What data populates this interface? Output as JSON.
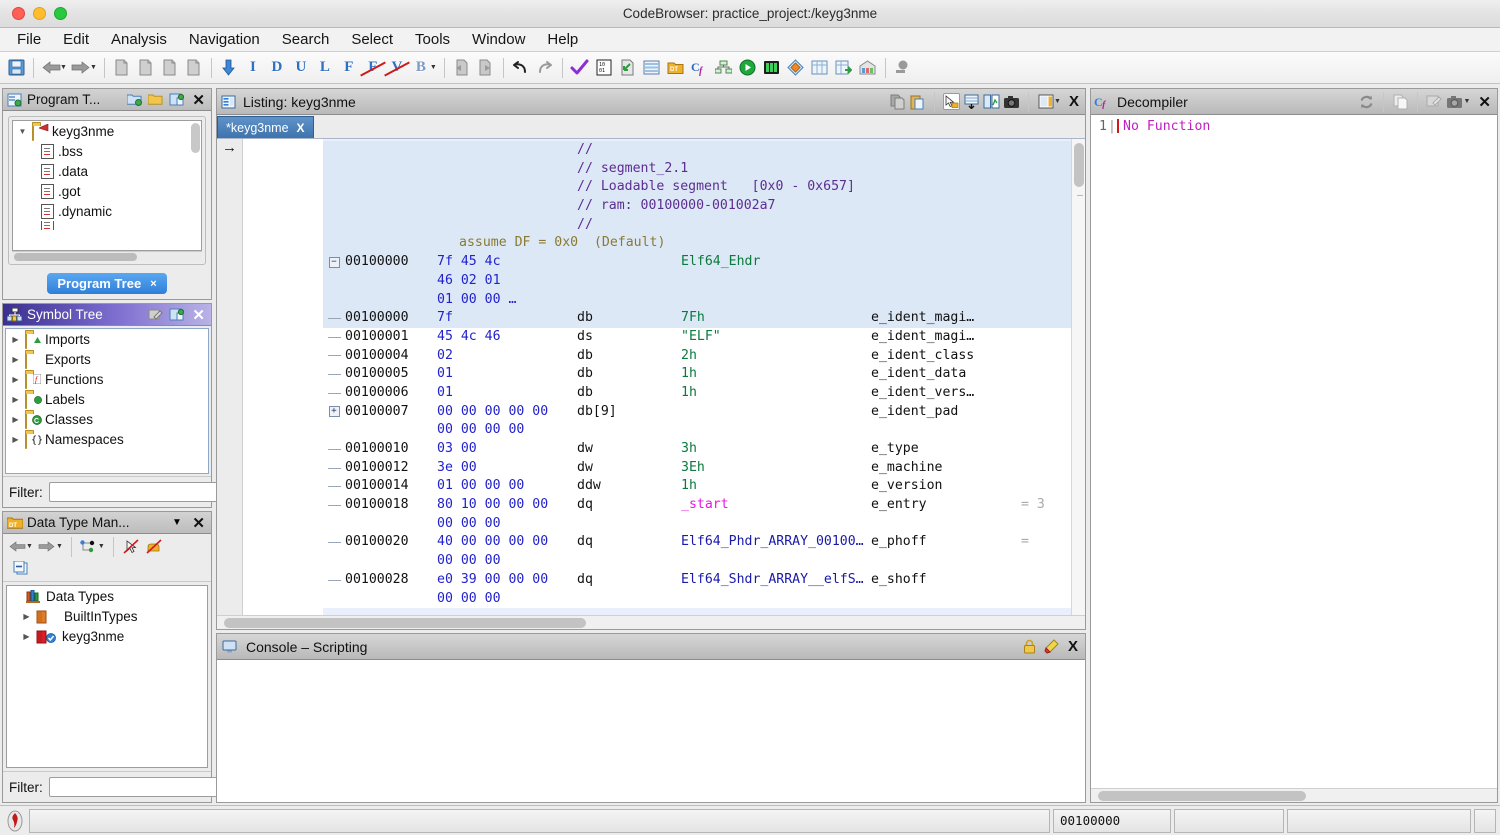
{
  "window": {
    "title": "CodeBrowser: practice_project:/keyg3nme",
    "traffic_lights": [
      "close",
      "minimize",
      "maximize"
    ]
  },
  "menubar": {
    "items": [
      "File",
      "Edit",
      "Analysis",
      "Navigation",
      "Search",
      "Select",
      "Tools",
      "Window",
      "Help"
    ]
  },
  "toolbar": {
    "groups": [
      {
        "icons": [
          "save-icon"
        ]
      },
      {
        "icons": [
          "back-arrow-icon",
          "forward-arrow-icon"
        ]
      },
      {
        "icons": [
          "snapshot-icon-1",
          "snapshot-icon-2",
          "snapshot-icon-3",
          "snapshot-icon-4"
        ]
      },
      {
        "icons": [
          "down-arrow-icon"
        ],
        "letters": [
          "I",
          "D",
          "U",
          "L",
          "F",
          "F-strike",
          "V-strike",
          "B"
        ]
      },
      {
        "icons": [
          "diff-prev-icon",
          "diff-next-icon"
        ]
      },
      {
        "icons": [
          "undo-icon",
          "redo-icon"
        ]
      },
      {
        "icons": [
          "check-icon",
          "bytes-icon",
          "export-icon",
          "memory-map-icon",
          "data-type-icon",
          "function-graph-icon",
          "tree-icon",
          "run-icon",
          "script-manager-icon",
          "diamond-icon",
          "table-icon",
          "table-export-icon",
          "archive-icon"
        ]
      },
      {
        "icons": [
          "about-icon"
        ]
      }
    ]
  },
  "program_tree": {
    "title": "Program T...",
    "header_icons": [
      "new-folder-icon",
      "open-folder-icon",
      "paste-icon"
    ],
    "close_label": "✕",
    "root": "keyg3nme",
    "nodes": [
      ".bss",
      ".data",
      ".got",
      ".dynamic"
    ],
    "tab_label": "Program Tree",
    "tab_close": "×"
  },
  "symbol_tree": {
    "title": "Symbol Tree",
    "header_icons": [
      "edit-icon",
      "paste-icon"
    ],
    "close_label": "✕",
    "nodes": [
      {
        "label": "Imports",
        "badge": "import"
      },
      {
        "label": "Exports",
        "badge": "none"
      },
      {
        "label": "Functions",
        "badge": "function"
      },
      {
        "label": "Labels",
        "badge": "label"
      },
      {
        "label": "Classes",
        "badge": "class"
      },
      {
        "label": "Namespaces",
        "badge": "namespace"
      }
    ],
    "filter_label": "Filter:",
    "filter_value": "",
    "filter_placeholder": ""
  },
  "data_type_manager": {
    "title": "Data Type Man...",
    "menu_label": "▾",
    "close_label": "✕",
    "toolbar_icons": [
      "back-arrow-icon",
      "forward-arrow-icon",
      "filter-tree-icon",
      "no-pointer-icon",
      "no-hand-icon",
      "collapse-all-icon"
    ],
    "root": "Data Types",
    "nodes": [
      {
        "label": "BuiltInTypes",
        "checked": false
      },
      {
        "label": "keyg3nme",
        "checked": true
      }
    ],
    "filter_label": "Filter:",
    "filter_value": "",
    "filter_placeholder": ""
  },
  "listing": {
    "title": "Listing:  keyg3nme",
    "header_icons": [
      "copy-icon",
      "paste-icon",
      "select-cursor-icon",
      "snapshot-down-icon",
      "diff-view-icon",
      "camera-icon",
      "layout-icon",
      "dropdown-caret-icon"
    ],
    "close_label": "X",
    "tab_label": "*keyg3nme",
    "tab_close": "X",
    "cursor_arrow": "→",
    "rows": [
      {
        "type": "comment",
        "toggle": "",
        "addr": "",
        "bytes": "",
        "mnem": "",
        "text": "//",
        "field": "",
        "sel": true
      },
      {
        "type": "comment",
        "toggle": "",
        "addr": "",
        "bytes": "",
        "mnem": "",
        "text": "// segment_2.1",
        "field": "",
        "sel": true
      },
      {
        "type": "comment",
        "toggle": "",
        "addr": "",
        "bytes": "",
        "mnem": "",
        "text": "// Loadable segment   [0x0 - 0x657]",
        "field": "",
        "sel": true
      },
      {
        "type": "comment",
        "toggle": "",
        "addr": "",
        "bytes": "",
        "mnem": "",
        "text": "// ram: 00100000-001002a7",
        "field": "",
        "sel": true
      },
      {
        "type": "comment",
        "toggle": "",
        "addr": "",
        "bytes": "",
        "mnem": "",
        "text": "//",
        "field": "",
        "sel": true
      },
      {
        "type": "assume",
        "toggle": "",
        "addr": "",
        "bytes": "",
        "mnem": "",
        "text": "assume DF = 0x0  (Default)",
        "field": "",
        "sel": true
      },
      {
        "type": "struct",
        "toggle": "minus",
        "addr": "00100000",
        "bytes": "7f 45 4c",
        "mnem": "",
        "value": "Elf64_Ehdr",
        "value_kind": "plain",
        "field": "",
        "sel": true
      },
      {
        "type": "cont",
        "toggle": "",
        "addr": "",
        "bytes": "46 02 01",
        "mnem": "",
        "value": "",
        "field": "",
        "sel": true
      },
      {
        "type": "cont",
        "toggle": "",
        "addr": "",
        "bytes": "01 00 00 …",
        "mnem": "",
        "value": "",
        "field": "",
        "sel": true
      },
      {
        "type": "data",
        "toggle": "dash",
        "addr": "00100000",
        "bytes": "7f",
        "mnem": "db",
        "value": "7Fh",
        "value_kind": "const",
        "field": "e_ident_magi…",
        "sel": true
      },
      {
        "type": "data",
        "toggle": "dash",
        "addr": "00100001",
        "bytes": "45 4c 46",
        "mnem": "ds",
        "value": "\"ELF\"",
        "value_kind": "const",
        "field": "e_ident_magi…",
        "sel": false
      },
      {
        "type": "data",
        "toggle": "dash",
        "addr": "00100004",
        "bytes": "02",
        "mnem": "db",
        "value": "2h",
        "value_kind": "const",
        "field": "e_ident_class",
        "sel": false
      },
      {
        "type": "data",
        "toggle": "dash",
        "addr": "00100005",
        "bytes": "01",
        "mnem": "db",
        "value": "1h",
        "value_kind": "const",
        "field": "e_ident_data",
        "sel": false
      },
      {
        "type": "data",
        "toggle": "dash",
        "addr": "00100006",
        "bytes": "01",
        "mnem": "db",
        "value": "1h",
        "value_kind": "const",
        "field": "e_ident_vers…",
        "sel": false
      },
      {
        "type": "data",
        "toggle": "plus",
        "addr": "00100007",
        "bytes": "00 00 00 00 00",
        "mnem": "db[9]",
        "value": "",
        "value_kind": "const",
        "field": "e_ident_pad",
        "sel": false
      },
      {
        "type": "cont",
        "toggle": "",
        "addr": "",
        "bytes": "00 00 00 00",
        "mnem": "",
        "value": "",
        "field": "",
        "sel": false
      },
      {
        "type": "data",
        "toggle": "dash",
        "addr": "00100010",
        "bytes": "03 00",
        "mnem": "dw",
        "value": "3h",
        "value_kind": "const",
        "field": "e_type",
        "sel": false
      },
      {
        "type": "data",
        "toggle": "dash",
        "addr": "00100012",
        "bytes": "3e 00",
        "mnem": "dw",
        "value": "3Eh",
        "value_kind": "const",
        "field": "e_machine",
        "sel": false
      },
      {
        "type": "data",
        "toggle": "dash",
        "addr": "00100014",
        "bytes": "01 00 00 00",
        "mnem": "ddw",
        "value": "1h",
        "value_kind": "const",
        "field": "e_version",
        "sel": false
      },
      {
        "type": "data",
        "toggle": "dash",
        "addr": "00100018",
        "bytes": "80 10 00 00 00",
        "mnem": "dq",
        "value": "_start",
        "value_kind": "fn",
        "field": "e_entry",
        "eq": "= 3",
        "sel": false
      },
      {
        "type": "cont",
        "toggle": "",
        "addr": "",
        "bytes": "00 00 00",
        "mnem": "",
        "value": "",
        "field": "",
        "sel": false
      },
      {
        "type": "data",
        "toggle": "dash",
        "addr": "00100020",
        "bytes": "40 00 00 00 00",
        "mnem": "dq",
        "value": "Elf64_Phdr_ARRAY_00100…",
        "value_kind": "ref",
        "field": "e_phoff",
        "eq": "=",
        "sel": false
      },
      {
        "type": "cont",
        "toggle": "",
        "addr": "",
        "bytes": "00 00 00",
        "mnem": "",
        "value": "",
        "field": "",
        "sel": false
      },
      {
        "type": "data",
        "toggle": "dash",
        "addr": "00100028",
        "bytes": "e0 39 00 00 00",
        "mnem": "dq",
        "value": "Elf64_Shdr_ARRAY__elfS…",
        "value_kind": "ref",
        "field": "e_shoff",
        "sel": false
      },
      {
        "type": "cont",
        "toggle": "",
        "addr": "",
        "bytes": "00 00 00",
        "mnem": "",
        "value": "",
        "field": "",
        "sel": false
      }
    ]
  },
  "decompiler": {
    "title": "Decompiler",
    "header_icons": [
      "refresh-icon",
      "copy-icon",
      "edit-icon",
      "camera-icon",
      "dropdown-caret-icon"
    ],
    "close_label": "✕",
    "lines": [
      {
        "num": "1",
        "text": "No Function"
      }
    ]
  },
  "console": {
    "title": "Console – Scripting",
    "header_icons": [
      "lock-icon",
      "clear-icon"
    ],
    "close_label": "X",
    "content": ""
  },
  "statusbar": {
    "icon": "ghidra-dragon-icon",
    "message": "",
    "address": "00100000",
    "field_2": "",
    "field_3": "",
    "field_4": ""
  },
  "colors": {
    "accent_blue": "#2f7fd9",
    "selection": "#e9f0fb",
    "comment": "#5c2d91",
    "bytes": "#2222cc",
    "constant": "#0a7a3e",
    "function": "#e618e6",
    "reference": "#1a1aaa",
    "symbol_tree_header": "#3a2f8f"
  }
}
